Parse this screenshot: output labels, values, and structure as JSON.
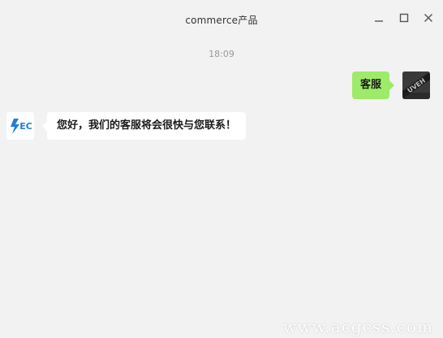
{
  "window": {
    "title": "commerce产品"
  },
  "controls": {
    "minimize": "minimize-icon",
    "maximize": "maximize-icon",
    "close": "close-icon"
  },
  "chat": {
    "timestamp": "18:09",
    "messages": [
      {
        "direction": "outgoing",
        "text": "客服",
        "avatar": "user-avatar"
      },
      {
        "direction": "incoming",
        "text": "您好，我们的客服将会很快与您联系！",
        "avatar": "ec-logo-avatar"
      }
    ]
  },
  "bot_avatar": {
    "text": "EC"
  },
  "watermark": {
    "text": "www.acgcss.com"
  },
  "colors": {
    "background": "#f2f2f2",
    "outgoing_bubble": "#9eea6a",
    "incoming_bubble": "#ffffff",
    "logo_blue": "#1e7fd6"
  }
}
